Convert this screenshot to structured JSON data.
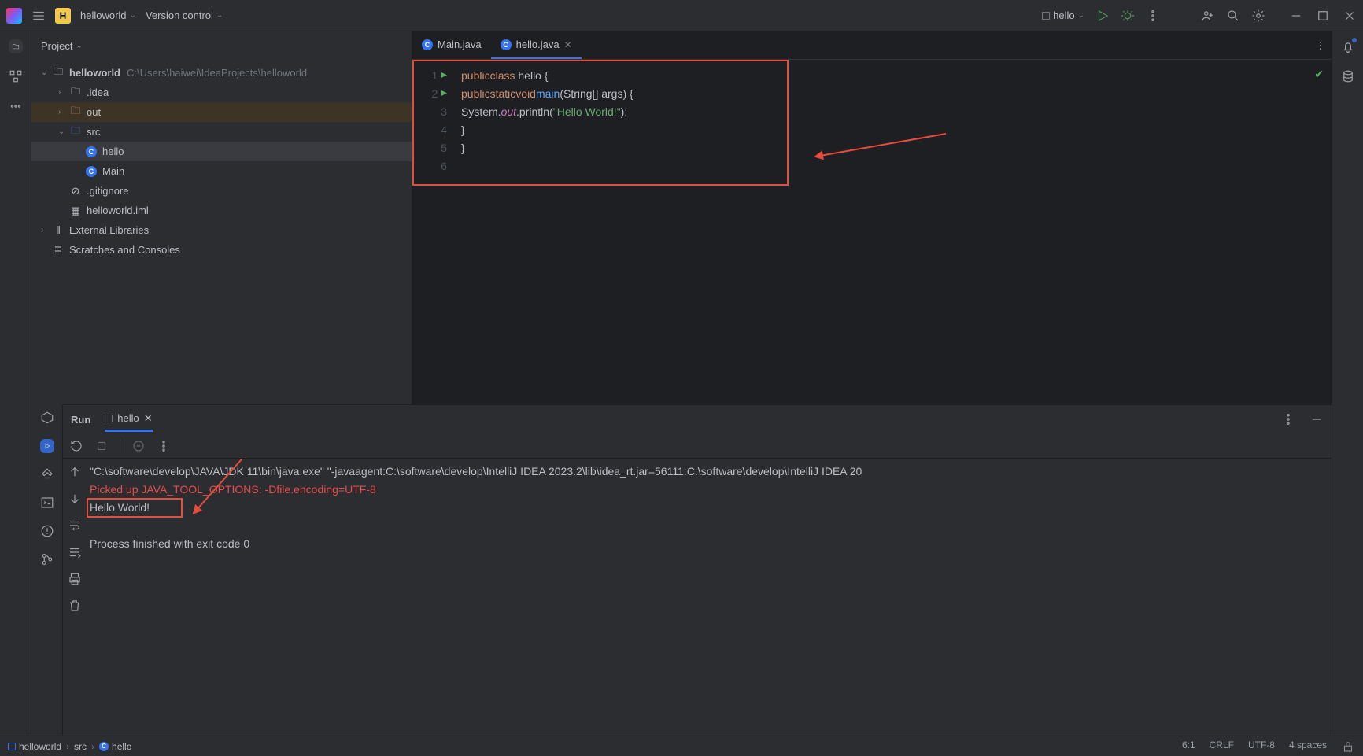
{
  "titlebar": {
    "project_dd": "helloworld",
    "vcs_dd": "Version control",
    "run_cfg": "hello"
  },
  "project": {
    "panel_title": "Project",
    "root": "helloworld",
    "root_path": "C:\\Users\\haiwei\\IdeaProjects\\helloworld",
    "idea": ".idea",
    "out": "out",
    "src": "src",
    "hello": "hello",
    "main": "Main",
    "gitignore": ".gitignore",
    "iml": "helloworld.iml",
    "extlib": "External Libraries",
    "scratches": "Scratches and Consoles"
  },
  "editor": {
    "tab1": "Main.java",
    "tab2": "hello.java",
    "lines": {
      "n1": "1",
      "n2": "2",
      "n3": "3",
      "n4": "4",
      "n5": "5",
      "n6": "6"
    },
    "code": {
      "l1a": "public",
      "l1b": "class",
      "l1c": " hello {",
      "l2a": "public",
      "l2b": "static",
      "l2c": "void",
      "l2d": "main",
      "l2e": "(String[] args) {",
      "l3a": "System.",
      "l3b": "out",
      "l3c": ".println(",
      "l3d": "\"Hello World!\"",
      "l3e": ");",
      "l4": "}",
      "l5": "}"
    }
  },
  "run": {
    "label": "Run",
    "tab": "hello",
    "console": {
      "l1": "\"C:\\software\\develop\\JAVA\\JDK 11\\bin\\java.exe\" \"-javaagent:C:\\software\\develop\\IntelliJ IDEA 2023.2\\lib\\idea_rt.jar=56111:C:\\software\\develop\\IntelliJ IDEA 20",
      "l2": "Picked up JAVA_TOOL_OPTIONS: -Dfile.encoding=UTF-8",
      "l3": "Hello World!",
      "l4": "",
      "l5": "Process finished with exit code 0"
    }
  },
  "navbar": {
    "c1": "helloworld",
    "c2": "src",
    "c3": "hello",
    "pos": "6:1",
    "eol": "CRLF",
    "enc": "UTF-8",
    "indent": "4 spaces"
  }
}
